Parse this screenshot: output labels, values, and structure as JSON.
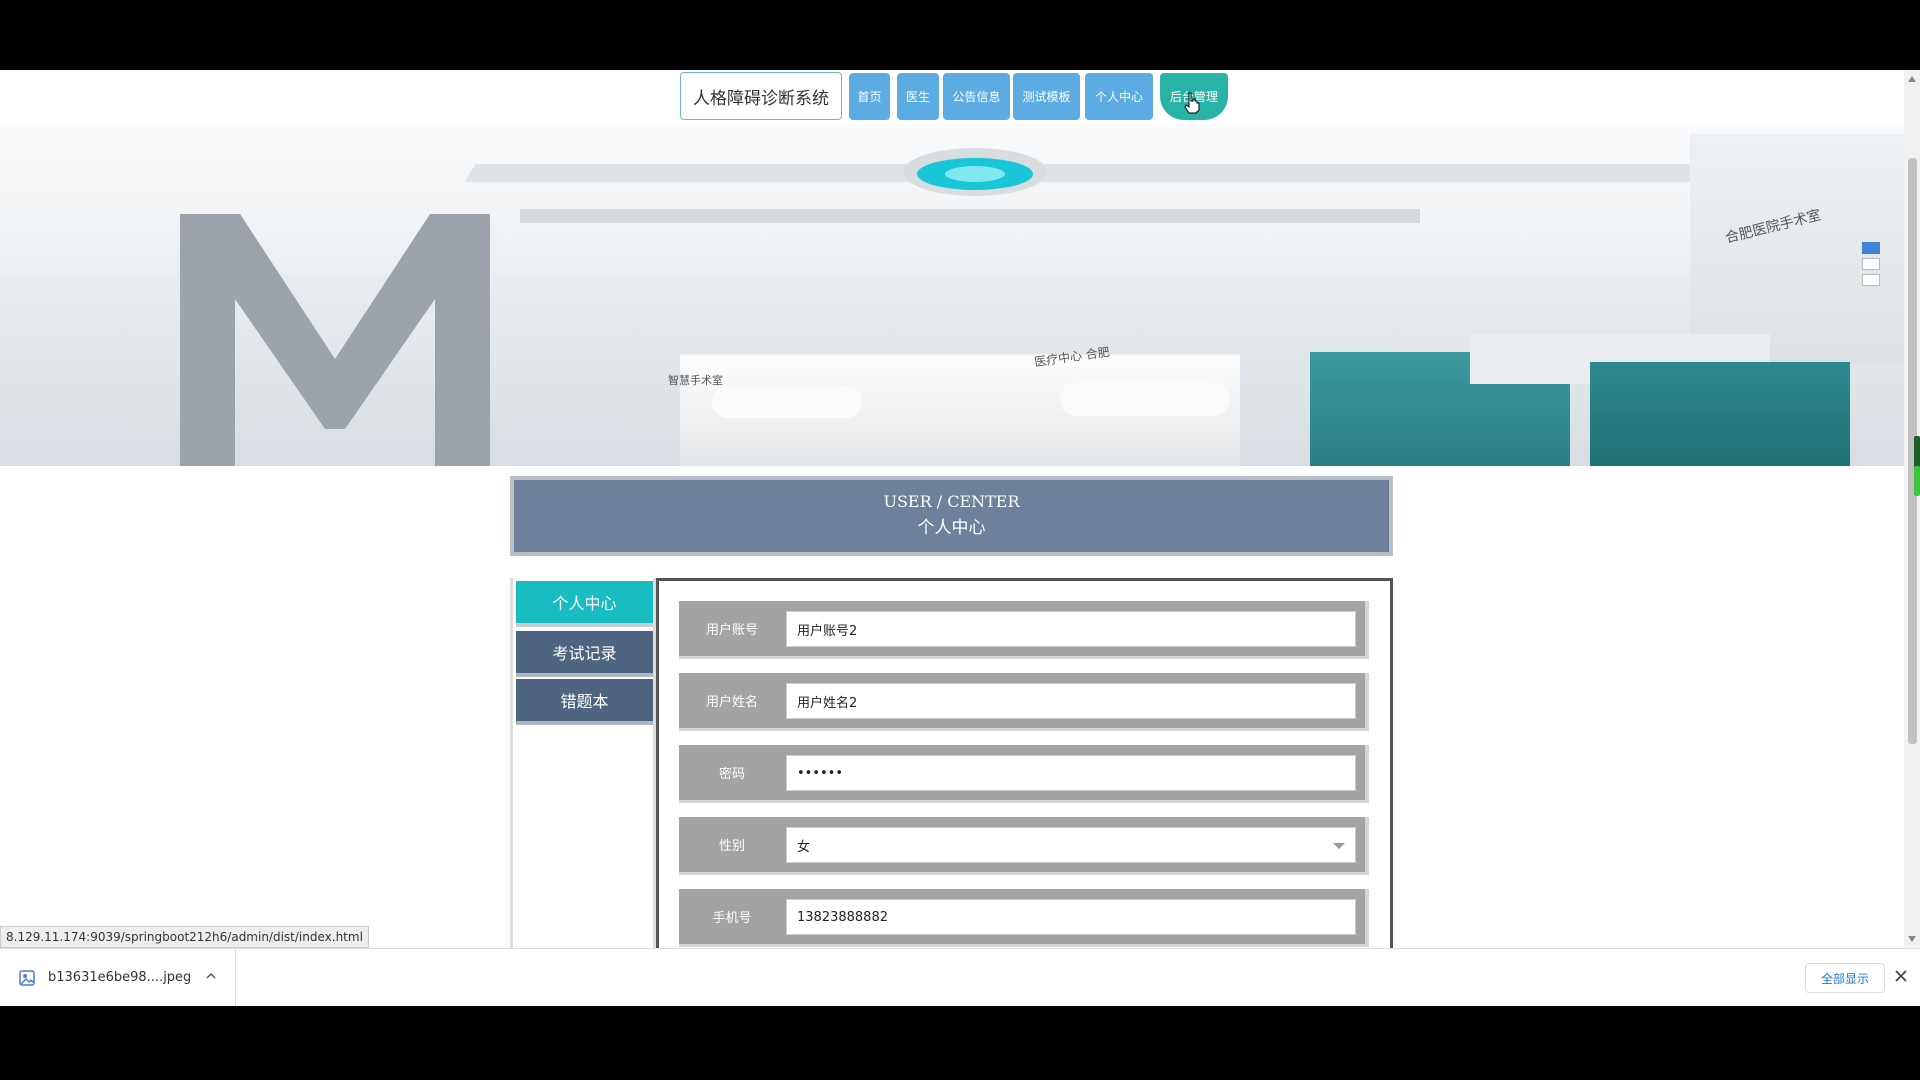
{
  "nav": {
    "brand": "人格障碍诊断系统",
    "items": [
      {
        "label": "首页"
      },
      {
        "label": "医生"
      },
      {
        "label": "公告信息"
      },
      {
        "label": "测试模板"
      },
      {
        "label": "个人中心"
      },
      {
        "label": "后台管理"
      }
    ]
  },
  "user_center": {
    "title_en": "USER / CENTER",
    "title_cn": "个人中心"
  },
  "side_menu": {
    "items": [
      {
        "label": "个人中心",
        "active": true
      },
      {
        "label": "考试记录"
      },
      {
        "label": "错题本"
      }
    ]
  },
  "form": {
    "fields": [
      {
        "label": "用户账号",
        "value": "用户账号2"
      },
      {
        "label": "用户姓名",
        "value": "用户姓名2"
      },
      {
        "label": "密码",
        "value": "••••••"
      },
      {
        "label": "性别",
        "value": "女"
      },
      {
        "label": "手机号",
        "value": "13823888882"
      }
    ]
  },
  "status_url": "8.129.11.174:9039/springboot212h6/admin/dist/index.html",
  "downloads": {
    "file_name": "b13631e6be98....jpeg",
    "show_all": "全部显示"
  },
  "colors": {
    "nav_button": "#5cabe3",
    "nav_active": "#29b3a7",
    "header_bg": "#6c819b",
    "side_active": "#19bcc0",
    "side_normal": "#4d6580",
    "row_bg": "#a3a3a3"
  },
  "hero_text": {
    "sign_right": "合肥医院手术室",
    "sign_mid": "医疗中心 合肥",
    "sign_left": "智慧手术室"
  }
}
